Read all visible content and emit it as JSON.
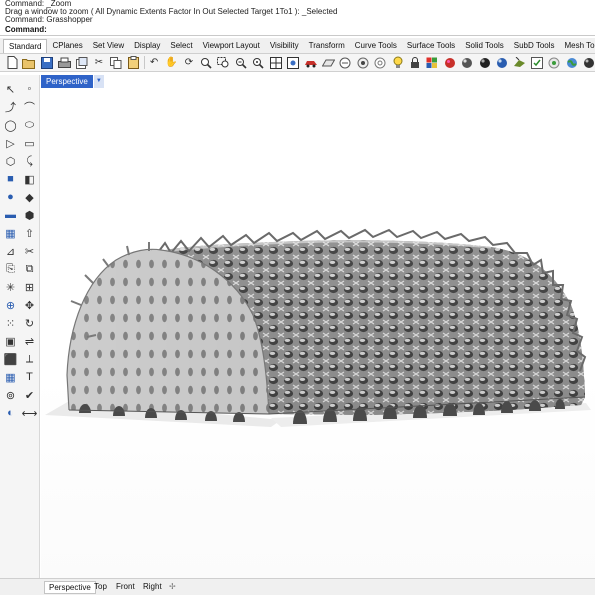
{
  "command_history": [
    "Command: _Zoom",
    "Drag a window to zoom ( All  Dynamic  Extents  Factor  In  Out  Selected  Target  1To1 ): _Selected",
    "Command: Grasshopper"
  ],
  "command_prompt": "Command:",
  "tool_tabs": [
    "Standard",
    "CPlanes",
    "Set View",
    "Display",
    "Select",
    "Viewport Layout",
    "Visibility",
    "Transform",
    "Curve Tools",
    "Surface Tools",
    "Solid Tools",
    "SubD Tools",
    "Mesh To"
  ],
  "active_tool_tab": "Standard",
  "toolbar_icons": [
    "new-file-icon",
    "open-file-icon",
    "save-icon",
    "print-icon",
    "import-icon",
    "cut-icon",
    "copy-icon",
    "paste-icon",
    "undo-icon",
    "pan-hand-icon",
    "rotate-view-icon",
    "zoom-icon",
    "zoom-window-icon",
    "zoom-extents-icon",
    "zoom-selected-icon",
    "view-4-icon",
    "named-views-icon",
    "car-render-icon",
    "cplane-icon",
    "display-mode-icon",
    "hide-icon",
    "show-icon",
    "lightbulb-icon",
    "lock-icon",
    "layers-icon",
    "shade-icon",
    "render-sphere-icon",
    "material-sphere-icon",
    "render-icon",
    "grasshopper-icon",
    "options-icon",
    "check-icon",
    "globe-icon",
    "help-icon"
  ],
  "left_toolbar_icons": [
    [
      "select-arrow-icon",
      "point-icon"
    ],
    [
      "polyline-icon",
      "curve-icon"
    ],
    [
      "circle-icon",
      "ellipse-icon"
    ],
    [
      "arc-icon",
      "rectangle-icon"
    ],
    [
      "polygon-icon",
      "curve-edit-icon"
    ],
    [
      "box-icon",
      "surface-icon"
    ],
    [
      "sphere-icon",
      "solid-icon"
    ],
    [
      "cylinder-icon",
      "boolean-icon"
    ],
    [
      "mesh-icon",
      "extrude-icon"
    ],
    [
      "fillet-icon",
      "trim-icon"
    ],
    [
      "split-icon",
      "join-icon"
    ],
    [
      "explode-icon",
      "group-icon"
    ],
    [
      "gumball-icon",
      "move-icon"
    ],
    [
      "array-icon",
      "rotate-icon"
    ],
    [
      "block-icon",
      "mirror-icon"
    ],
    [
      "cube-icon",
      "dimension-icon"
    ],
    [
      "grid-icon",
      "text-icon"
    ],
    [
      "analyze-icon",
      "check-icon"
    ],
    [
      "render-preview-icon",
      "dimension-linear-icon"
    ]
  ],
  "viewport": {
    "label": "Perspective"
  },
  "view_tabs": [
    "Perspective",
    "Top",
    "Front",
    "Right"
  ],
  "active_view_tab": "Perspective",
  "add_view_glyph": "✢",
  "colors": {
    "viewport_label": "#2f63c8",
    "viewport_bg": "#ffffff",
    "model_metal": "#8a8a8a"
  }
}
